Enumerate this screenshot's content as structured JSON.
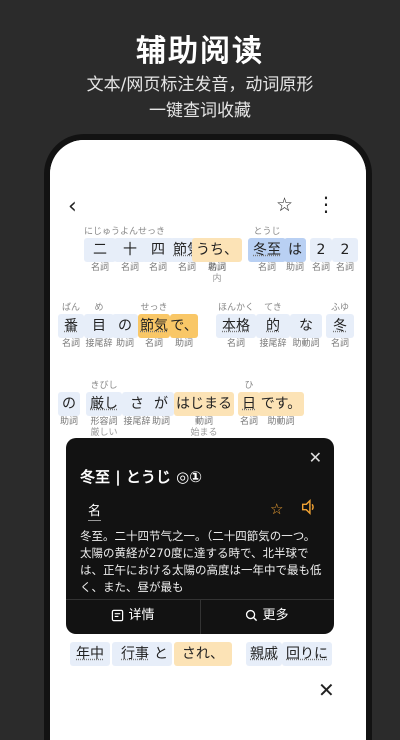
{
  "header": {
    "title": "辅助阅读",
    "subtitle_1": "文本/网页标注发音，动词原形",
    "subtitle_2": "一键查词收藏"
  },
  "toolbar": {
    "back_icon": "‹",
    "star_icon": "☆",
    "more_icon": "⋮"
  },
  "line1": {
    "t1": {
      "ruby": "にじゅうよんせっき",
      "base": "二",
      "pos": "名詞"
    },
    "t2": {
      "ruby": "",
      "base": "十",
      "pos": "名詞"
    },
    "t3": {
      "ruby": "",
      "base": "四",
      "pos": "名詞"
    },
    "t4": {
      "ruby": "",
      "base": "節気",
      "pos": "名詞"
    },
    "t5": {
      "ruby": "",
      "base": "の",
      "pos": "助詞"
    },
    "t6": {
      "ruby": "",
      "base": "うち、",
      "pos": "名詞",
      "pos2": "内"
    },
    "t7": {
      "ruby": "とうじ",
      "base": "冬至",
      "pos": "名詞"
    },
    "t8": {
      "ruby": "",
      "base": "は",
      "pos": "助詞"
    },
    "t9": {
      "ruby": "",
      "base": "2",
      "pos": "名詞"
    },
    "t10": {
      "ruby": "",
      "base": "2",
      "pos": "名詞"
    }
  },
  "line2": {
    "t1": {
      "ruby": "ばん",
      "base": "番",
      "pos": "名詞"
    },
    "t2": {
      "ruby": "め",
      "base": "目",
      "pos": "接尾辞"
    },
    "t3": {
      "ruby": "",
      "base": "の",
      "pos": "助詞"
    },
    "t4": {
      "ruby": "せっき",
      "base": "節気",
      "pos": "名詞"
    },
    "t5": {
      "ruby": "",
      "base": "で、",
      "pos": "助詞"
    },
    "t6": {
      "ruby": "ほんかく",
      "base": "本格",
      "pos": "名詞"
    },
    "t7": {
      "ruby": "てき",
      "base": "的",
      "pos": "接尾辞"
    },
    "t8": {
      "ruby": "",
      "base": "な",
      "pos": "助動詞"
    },
    "t9": {
      "ruby": "ふゆ",
      "base": "冬",
      "pos": "名詞"
    }
  },
  "line3": {
    "t1": {
      "ruby": "",
      "base": "の",
      "pos": "助詞"
    },
    "t2": {
      "ruby": "きびし",
      "base": "厳し",
      "pos": "形容詞",
      "pos2": "厳しい"
    },
    "t3": {
      "ruby": "",
      "base": "さ",
      "pos": "接尾辞"
    },
    "t4": {
      "ruby": "",
      "base": "が",
      "pos": "助詞"
    },
    "t5": {
      "ruby": "",
      "base": "はじまる",
      "pos": "動詞",
      "pos2": "始まる"
    },
    "t6": {
      "ruby": "ひ",
      "base": "日",
      "pos": "名詞"
    },
    "t7": {
      "ruby": "",
      "base": "です。",
      "pos": "助動詞"
    }
  },
  "line4": {
    "t1": {
      "base": "年中"
    },
    "t2": {
      "base": "行事"
    },
    "t3": {
      "base": "と"
    },
    "t4": {
      "base": "され、"
    },
    "t5": {
      "base": "親戚"
    },
    "t6": {
      "base": "回りに"
    }
  },
  "popup": {
    "title": "冬至 | とうじ ◎①",
    "pos": "名",
    "definition": "冬至。二十四节气之一。（二十四節気の一つ。太陽の黄経が270度に達する時で、北半球では、正午における太陽の高度は一年中で最も低く、また、昼が最も",
    "detail_label": "详情",
    "more_label": "更多",
    "close_icon": "✕",
    "star_icon": "☆"
  },
  "bottom": {
    "close_icon": "✕"
  }
}
